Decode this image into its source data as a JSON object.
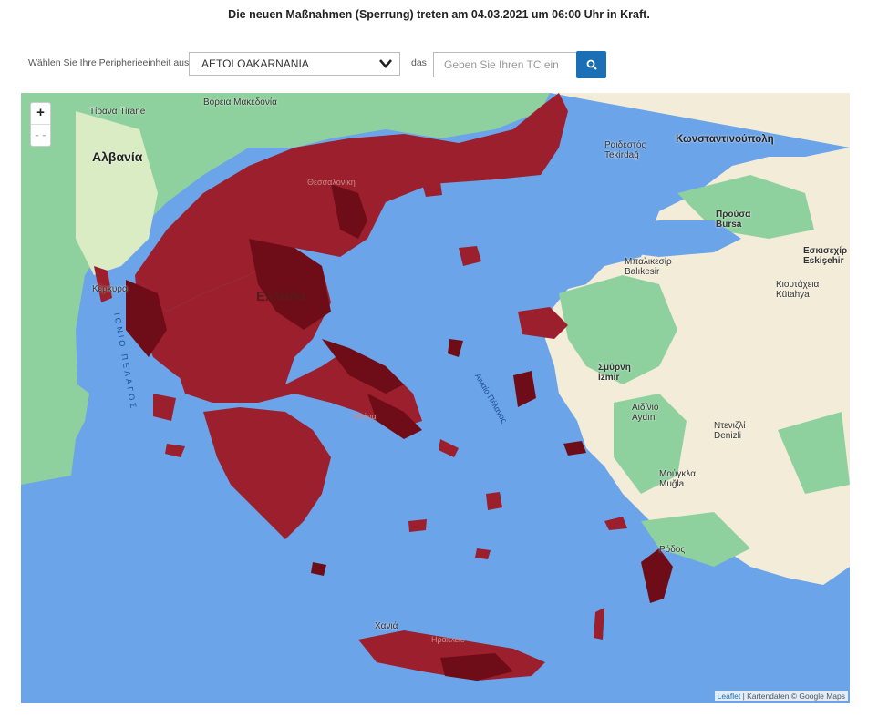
{
  "notice": "Die neuen Maßnahmen (Sperrung) treten am 04.03.2021 um 06:00 Uhr in Kraft.",
  "selector": {
    "label": "Wählen Sie Ihre Peripherieeinheit aus",
    "selected_value": "AETOLOAKARNANIA",
    "conjunction": "das",
    "tc_placeholder": "Geben Sie Ihren TC ein",
    "search_icon": "search-icon"
  },
  "zoom": {
    "in_label": "+",
    "out_label": "- -"
  },
  "map_labels": {
    "albania": "Αλβανία",
    "greece": "Ελλάδα",
    "tirana": "Τίρανα Tiranë",
    "macedonia": "Βόρεια Μακεδονία",
    "kerkyra": "Κέρκυρα",
    "istanbul": "Κωνσταντινούπολη",
    "tekirdag": "Ραιδεστός Tekirdağ",
    "bursa": "Προύσα Bursa",
    "eskisehir": "Εσκισεχίρ Eskişehir",
    "balikesir": "Μπαλικεσίρ Balıkesir",
    "kutahya": "Κιουτάχεια Kütahya",
    "izmir": "Σμύρνη İzmir",
    "aydin": "Αϊδίνιο Aydın",
    "denizli": "Ντενιζλί Denizli",
    "mugla": "Μούγκλα Muğla",
    "rodos": "Ρόδος",
    "thessaloniki": "Θεσσαλονίκη",
    "athina": "Αθήνα",
    "chania": "Χανιά",
    "irakleio": "Ηράκλειο",
    "aegean": "Αιγαίο Πέλαγος",
    "ionian": "ΙΟΝΙΟ ΠΕΛΑΓΟΣ"
  },
  "attribution": {
    "leaflet": "Leaflet",
    "rest": "| Kartendaten © Google Maps"
  },
  "colors": {
    "sea": "#6ba4e9",
    "lockdown_red": "#9b1f2c",
    "dark_red": "#6e0d17",
    "land_green": "#8fd19e",
    "land_beige": "#f3ecd8",
    "button_blue": "#1a6fb5"
  }
}
